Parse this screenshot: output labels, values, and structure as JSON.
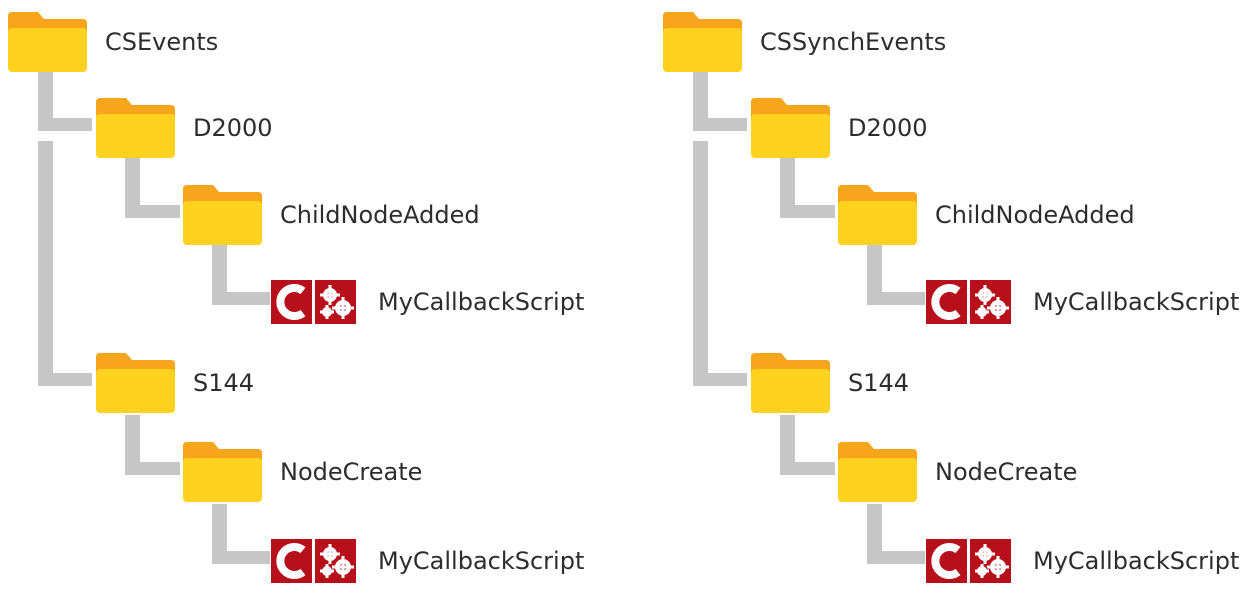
{
  "colors": {
    "folder_body": "#ffd21f",
    "folder_tab": "#f7a61c",
    "script_tile": "#b8101b",
    "connector": "#c6c6c6",
    "text": "#2d2d2d"
  },
  "icons": {
    "folder": "folder-icon",
    "script": "c-script-gears-icon"
  },
  "trees": [
    {
      "root": "CSEvents",
      "groups": [
        {
          "label": "D2000",
          "child": "ChildNodeAdded",
          "script": "MyCallbackScript"
        },
        {
          "label": "S144",
          "child": "NodeCreate",
          "script": "MyCallbackScript"
        }
      ]
    },
    {
      "root": "CSSynchEvents",
      "groups": [
        {
          "label": "D2000",
          "child": "ChildNodeAdded",
          "script": "MyCallbackScript"
        },
        {
          "label": "S144",
          "child": "NodeCreate",
          "script": "MyCallbackScript"
        }
      ]
    }
  ]
}
